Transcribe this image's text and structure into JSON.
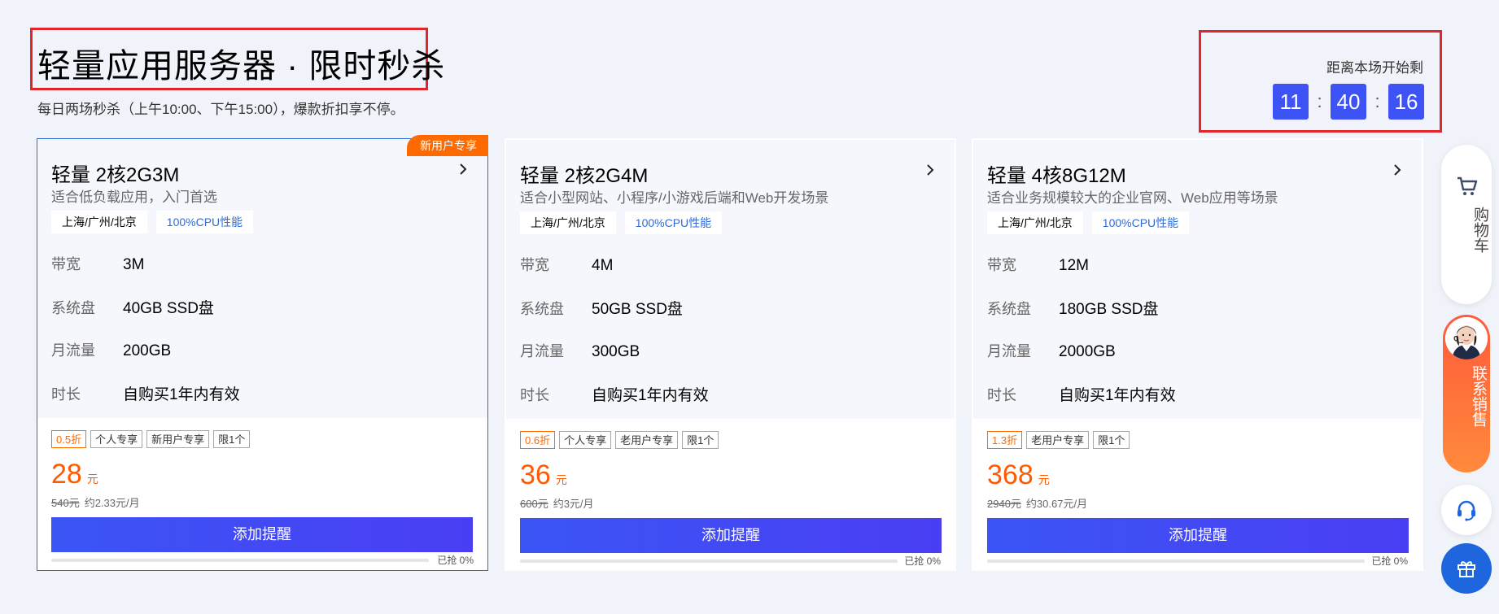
{
  "header": {
    "title": "轻量应用服务器 · 限时秒杀",
    "subtitle": "每日两场秒杀（上午10:00、下午15:00），爆款折扣享不停。"
  },
  "countdown": {
    "label": "距离本场开始剩",
    "hours": "11",
    "minutes": "40",
    "seconds": "16",
    "separator": ":"
  },
  "cards": [
    {
      "badge": "新用户专享",
      "name": "轻量 2核2G3M",
      "desc": "适合低负载应用，入门首选",
      "tag_location": "上海/广州/北京",
      "tag_cpu": "100%CPU性能",
      "specs": [
        {
          "k": "带宽",
          "v": "3M"
        },
        {
          "k": "系统盘",
          "v": "40GB SSD盘"
        },
        {
          "k": "月流量",
          "v": "200GB"
        },
        {
          "k": "时长",
          "v": "自购买1年内有效"
        }
      ],
      "chips": [
        "0.5折",
        "个人专享",
        "新用户专享",
        "限1个"
      ],
      "price": "28",
      "unit": "元",
      "original_price": "540元",
      "monthly": "约2.33元/月",
      "button": "添加提醒",
      "progress_label": "已抢 0%",
      "progress": 0
    },
    {
      "badge": "",
      "name": "轻量 2核2G4M",
      "desc": "适合小型网站、小程序/小游戏后端和Web开发场景",
      "tag_location": "上海/广州/北京",
      "tag_cpu": "100%CPU性能",
      "specs": [
        {
          "k": "带宽",
          "v": "4M"
        },
        {
          "k": "系统盘",
          "v": "50GB SSD盘"
        },
        {
          "k": "月流量",
          "v": "300GB"
        },
        {
          "k": "时长",
          "v": "自购买1年内有效"
        }
      ],
      "chips": [
        "0.6折",
        "个人专享",
        "老用户专享",
        "限1个"
      ],
      "price": "36",
      "unit": "元",
      "original_price": "600元",
      "monthly": "约3元/月",
      "button": "添加提醒",
      "progress_label": "已抢 0%",
      "progress": 0
    },
    {
      "badge": "",
      "name": "轻量 4核8G12M",
      "desc": "适合业务规模较大的企业官网、Web应用等场景",
      "tag_location": "上海/广州/北京",
      "tag_cpu": "100%CPU性能",
      "specs": [
        {
          "k": "带宽",
          "v": "12M"
        },
        {
          "k": "系统盘",
          "v": "180GB SSD盘"
        },
        {
          "k": "月流量",
          "v": "2000GB"
        },
        {
          "k": "时长",
          "v": "自购买1年内有效"
        }
      ],
      "chips": [
        "1.3折",
        "老用户专享",
        "限1个"
      ],
      "price": "368",
      "unit": "元",
      "original_price": "2940元",
      "monthly": "约30.67元/月",
      "button": "添加提醒",
      "progress_label": "已抢 0%",
      "progress": 0
    }
  ],
  "sidebar": {
    "cart_label": "购物车",
    "sales_label": "联系销售",
    "icons": [
      "cart-icon",
      "customer-service-icon",
      "gift-icon"
    ]
  },
  "colors": {
    "accent": "#3d53f5",
    "price": "#ff5a00",
    "badge": "#ff6a00",
    "highlight_border": "#2f6bd6",
    "annotation_red": "#e3242b"
  }
}
